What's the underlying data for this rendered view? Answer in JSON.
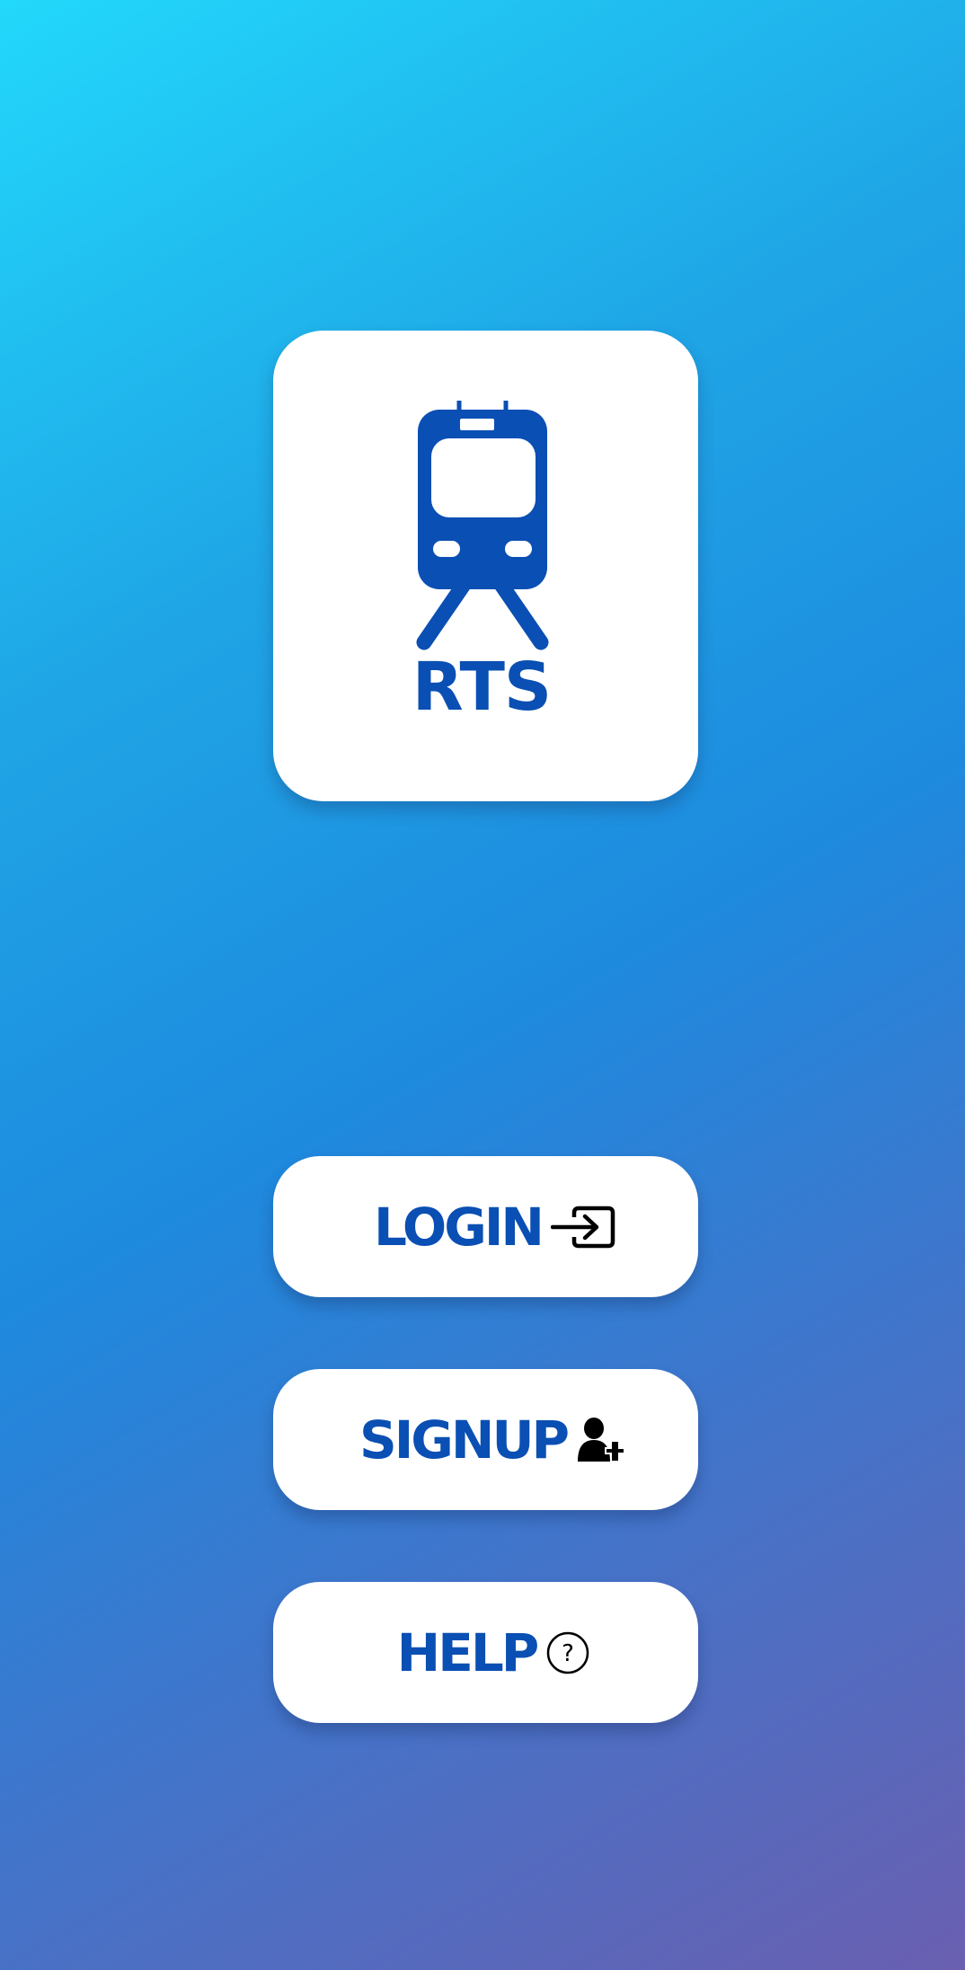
{
  "app": {
    "logo_text": "RTS",
    "logo_icon": "train-icon",
    "brand_color": "#0a4fb3"
  },
  "buttons": {
    "login": {
      "label": "LOGIN",
      "icon": "login-icon"
    },
    "signup": {
      "label": "SIGNUP",
      "icon": "add-user-icon"
    },
    "help": {
      "label": "HELP",
      "icon": "help-icon"
    }
  }
}
